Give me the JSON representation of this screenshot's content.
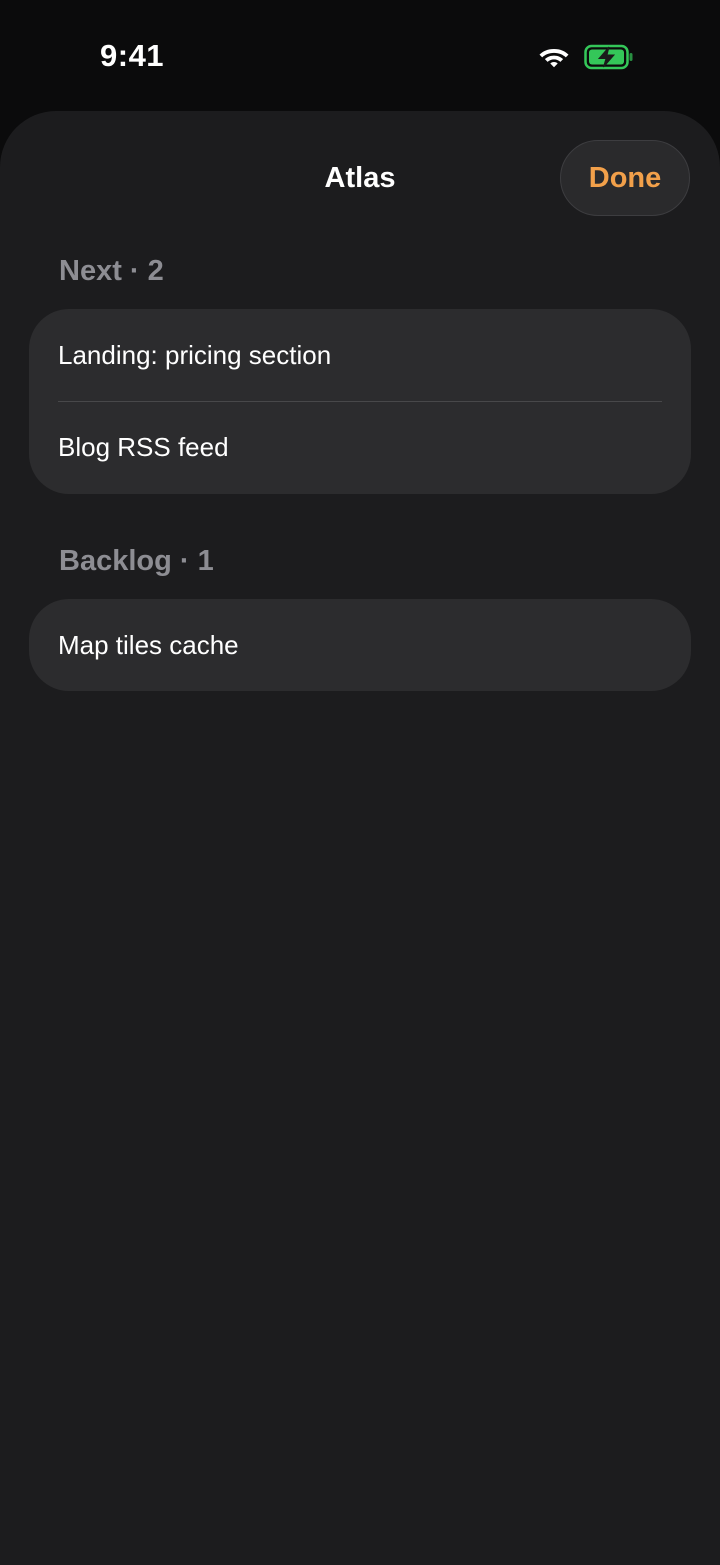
{
  "status_bar": {
    "time": "9:41",
    "wifi_icon": "wifi-icon",
    "battery_icon": "battery-charging-icon",
    "battery_color": "#34c759"
  },
  "sheet": {
    "title": "Atlas",
    "done_label": "Done",
    "accent_color": "#f2a04a"
  },
  "sections": [
    {
      "header": "Next · 2",
      "items": [
        {
          "label": "Landing: pricing section"
        },
        {
          "label": "Blog RSS feed"
        }
      ]
    },
    {
      "header": "Backlog · 1",
      "items": [
        {
          "label": "Map tiles cache"
        }
      ]
    }
  ]
}
